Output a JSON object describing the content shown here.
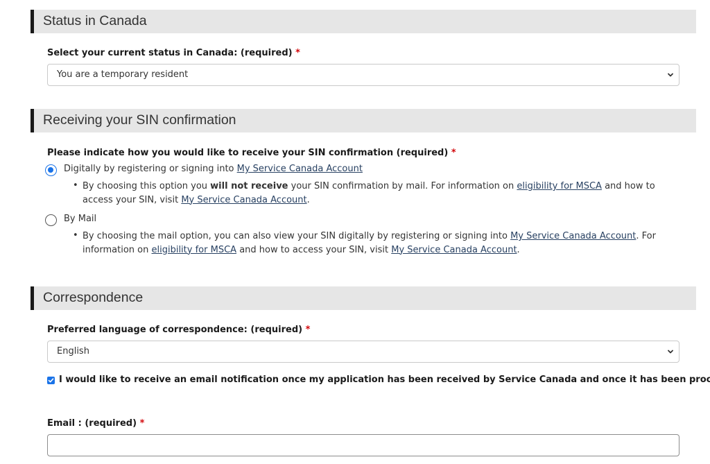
{
  "sections": {
    "status": {
      "title": "Status in Canada"
    },
    "sin": {
      "title": "Receiving your SIN confirmation"
    },
    "correspondence": {
      "title": "Correspondence"
    }
  },
  "status_field": {
    "label": "Select your current status in Canada: (required)",
    "required_mark": "*",
    "value": "You are a temporary resident"
  },
  "sin_field": {
    "label": "Please indicate how you would like to receive your SIN confirmation (required)",
    "required_mark": "*",
    "options": [
      {
        "text": "Digitally by registering or signing into",
        "link": "My Service Canada Account",
        "checked": true,
        "note": {
          "t1": "By choosing this option you",
          "bold": "will not receive",
          "t2": "your SIN confirmation by mail. For information on",
          "link1": "eligibility for MSCA",
          "t3": "and how to access your SIN, visit",
          "link2": "My Service Canada Account",
          "t4": "."
        }
      },
      {
        "text": "By Mail",
        "checked": false,
        "note": {
          "t1": "By choosing the mail option, you can also view your SIN digitally by registering or signing into",
          "link1": "My Service Canada Account",
          "t2": ". For information on",
          "link2": "eligibility for MSCA",
          "t3": "and how to access your SIN, visit",
          "link3": "My Service Canada Account",
          "t4": "."
        }
      }
    ]
  },
  "language_field": {
    "label": "Preferred language of correspondence: (required)",
    "required_mark": "*",
    "value": "English"
  },
  "notification": {
    "checked": true,
    "label": "I would like to receive an email notification once my application has been received by Service Canada and once it has been processed."
  },
  "email_field": {
    "label": "Email : (required)",
    "required_mark": "*",
    "value": ""
  },
  "colors": {
    "header_bg": "#e6e6e6",
    "accent_bar": "#1a1a1a",
    "required": "#d3080c",
    "link": "#284162",
    "control_blue": "#1a73e8"
  },
  "icons": {
    "select_arrow": "chevron-down-icon",
    "checkbox_mark": "checkmark-icon"
  }
}
